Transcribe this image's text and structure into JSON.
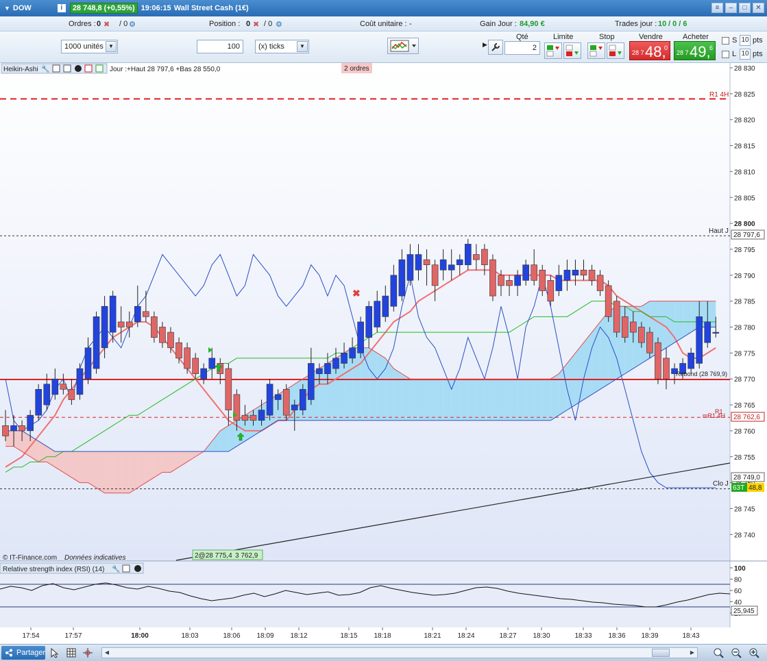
{
  "titlebar": {
    "symbol": "DOW",
    "price_badge": "28 748,8 (+0,55%)",
    "time": "19:06:15",
    "instrument": "Wall Street Cash (1€)"
  },
  "infobar": {
    "orders_label": "Ordres :",
    "orders_value": "0",
    "orders_slash": "/ 0",
    "position_label": "Position :",
    "position_value": "0",
    "position_slash": "/ 0",
    "unit_cost_label": "Coût unitaire :",
    "unit_cost_value": "-",
    "gain_label": "Gain Jour :",
    "gain_value": "84,90 €",
    "trades_label": "Trades jour :",
    "trades_value": "10",
    "trades_rest": "/ 0 / 6"
  },
  "controls": {
    "units_select": "1000 unités",
    "ticks_value": "100",
    "ticks_select": "(x) ticks",
    "qty_label": "Qté",
    "qty_value": "2",
    "limit_label": "Limite",
    "stop_label": "Stop",
    "sell_label": "Vendre",
    "buy_label": "Acheter",
    "sell_small": "28 7",
    "sell_big": "48,",
    "sell_sup": "0",
    "buy_small": "28 7",
    "buy_big": "49,",
    "buy_sup": "6",
    "s_label": "S",
    "l_label": "L",
    "s_pts_value": "10",
    "l_pts_value": "10",
    "pts_label": "pts"
  },
  "chart": {
    "indicator_name": "Heikin-Ashi",
    "day_info": "Jour :+Haut 28 797,6 +Bas 28 550,0",
    "orders_badge": "2 ordres",
    "copyright": "© IT-Finance.com",
    "disclaimer": "Données indicatives",
    "r1_4h_label": "R1 4H",
    "haut_j_label": "Haut J",
    "haut_j_value": "28 797,6",
    "rebond_label": "Rebond (28 769,9)",
    "r1_label": "R1",
    "mr1_label": "mR1 4H",
    "r1_value": "28 762,6",
    "clo_j_label": "Clo J",
    "last_value": "28 749,0",
    "counter_badge": "63T",
    "current_value": "48,8",
    "trendline_badge": "2@28 775,4",
    "trendline_value": "3 762,9",
    "y_ticks": [
      "28 830",
      "28 825",
      "28 820",
      "28 815",
      "28 810",
      "28 805",
      "28 800",
      "28 795",
      "28 790",
      "28 785",
      "28 780",
      "28 775",
      "28 770",
      "28 765",
      "28 760",
      "28 755",
      "28 750",
      "28 745",
      "28 740"
    ],
    "y_tick_bold_index": 6,
    "x_ticks": [
      "17:54",
      "17:57",
      "18:00",
      "18:03",
      "18:06",
      "18:09",
      "18:12",
      "18:15",
      "18:18",
      "18:21",
      "18:24",
      "18:27",
      "18:30",
      "18:33",
      "18:36",
      "18:39",
      "18:43"
    ],
    "x_tick_bold_index": 2
  },
  "rsi": {
    "title": "Relative strength index (RSI) (14)",
    "ticks": [
      "100",
      "80",
      "60",
      "40",
      "20"
    ],
    "current_value": "25,945"
  },
  "bottombar": {
    "share_label": "Partager"
  },
  "colors": {
    "bull_candle": "#2244dd",
    "bear_candle": "#e06666",
    "kumo_bull": "#a8dcf5",
    "kumo_bear": "#f3c8c8",
    "support_line": "#e02020"
  },
  "chart_data": {
    "type": "candlestick",
    "title": "DOW — Wall Street Cash (1€) — Heikin-Ashi",
    "ylim": [
      28737,
      28832
    ],
    "x_first_label": "17:54",
    "x_last_label": "18:43",
    "candles": [
      {
        "o": 28761,
        "h": 28764,
        "l": 28758,
        "c": 28759
      },
      {
        "o": 28760,
        "h": 28763,
        "l": 28757,
        "c": 28761
      },
      {
        "o": 28761,
        "h": 28762,
        "l": 28758,
        "c": 28760
      },
      {
        "o": 28760,
        "h": 28764,
        "l": 28758,
        "c": 28763
      },
      {
        "o": 28763,
        "h": 28769,
        "l": 28762,
        "c": 28768
      },
      {
        "o": 28765,
        "h": 28771,
        "l": 28764,
        "c": 28769
      },
      {
        "o": 28767,
        "h": 28772,
        "l": 28766,
        "c": 28770
      },
      {
        "o": 28769,
        "h": 28771,
        "l": 28767,
        "c": 28768
      },
      {
        "o": 28768,
        "h": 28770,
        "l": 28765,
        "c": 28766
      },
      {
        "o": 28767,
        "h": 28773,
        "l": 28766,
        "c": 28772
      },
      {
        "o": 28770,
        "h": 28778,
        "l": 28769,
        "c": 28776
      },
      {
        "o": 28772,
        "h": 28783,
        "l": 28771,
        "c": 28782
      },
      {
        "o": 28776,
        "h": 28786,
        "l": 28774,
        "c": 28784
      },
      {
        "o": 28779,
        "h": 28787,
        "l": 28777,
        "c": 28786
      },
      {
        "o": 28781,
        "h": 28784,
        "l": 28777,
        "c": 28780
      },
      {
        "o": 28781,
        "h": 28783,
        "l": 28778,
        "c": 28780
      },
      {
        "o": 28781,
        "h": 28788,
        "l": 28780,
        "c": 28784
      },
      {
        "o": 28783,
        "h": 28787,
        "l": 28781,
        "c": 28782
      },
      {
        "o": 28782,
        "h": 28783,
        "l": 28777,
        "c": 28778
      },
      {
        "o": 28780,
        "h": 28781,
        "l": 28776,
        "c": 28777
      },
      {
        "o": 28779,
        "h": 28780,
        "l": 28775,
        "c": 28776
      },
      {
        "o": 28777,
        "h": 28778,
        "l": 28773,
        "c": 28774
      },
      {
        "o": 28776,
        "h": 28777,
        "l": 28771,
        "c": 28772
      },
      {
        "o": 28774,
        "h": 28775,
        "l": 28770,
        "c": 28771
      },
      {
        "o": 28770,
        "h": 28773,
        "l": 28769,
        "c": 28772
      },
      {
        "o": 28772,
        "h": 28776,
        "l": 28770,
        "c": 28774
      },
      {
        "o": 28773,
        "h": 28774,
        "l": 28769,
        "c": 28771
      },
      {
        "o": 28772,
        "h": 28773,
        "l": 28761,
        "c": 28764
      },
      {
        "o": 28767,
        "h": 28768,
        "l": 28760,
        "c": 28762
      },
      {
        "o": 28763,
        "h": 28765,
        "l": 28761,
        "c": 28762
      },
      {
        "o": 28763,
        "h": 28764,
        "l": 28761,
        "c": 28762
      },
      {
        "o": 28762,
        "h": 28766,
        "l": 28761,
        "c": 28764
      },
      {
        "o": 28763,
        "h": 28770,
        "l": 28762,
        "c": 28769
      },
      {
        "o": 28766,
        "h": 28768,
        "l": 28764,
        "c": 28767
      },
      {
        "o": 28768,
        "h": 28769,
        "l": 28762,
        "c": 28763
      },
      {
        "o": 28764,
        "h": 28766,
        "l": 28760,
        "c": 28765
      },
      {
        "o": 28764,
        "h": 28769,
        "l": 28763,
        "c": 28768
      },
      {
        "o": 28766,
        "h": 28776,
        "l": 28765,
        "c": 28773
      },
      {
        "o": 28771,
        "h": 28773,
        "l": 28769,
        "c": 28772
      },
      {
        "o": 28771,
        "h": 28775,
        "l": 28769,
        "c": 28773
      },
      {
        "o": 28772,
        "h": 28776,
        "l": 28771,
        "c": 28774
      },
      {
        "o": 28773,
        "h": 28777,
        "l": 28772,
        "c": 28775
      },
      {
        "o": 28774,
        "h": 28778,
        "l": 28773,
        "c": 28776
      },
      {
        "o": 28775,
        "h": 28782,
        "l": 28774,
        "c": 28781
      },
      {
        "o": 28778,
        "h": 28785,
        "l": 28776,
        "c": 28784
      },
      {
        "o": 28780,
        "h": 28787,
        "l": 28779,
        "c": 28785
      },
      {
        "o": 28782,
        "h": 28788,
        "l": 28781,
        "c": 28786
      },
      {
        "o": 28784,
        "h": 28792,
        "l": 28783,
        "c": 28790
      },
      {
        "o": 28786,
        "h": 28795,
        "l": 28785,
        "c": 28793
      },
      {
        "o": 28789,
        "h": 28796,
        "l": 28788,
        "c": 28794
      },
      {
        "o": 28791,
        "h": 28796,
        "l": 28789,
        "c": 28794
      },
      {
        "o": 28793,
        "h": 28795,
        "l": 28788,
        "c": 28792
      },
      {
        "o": 28792,
        "h": 28793,
        "l": 28785,
        "c": 28788
      },
      {
        "o": 28791,
        "h": 28795,
        "l": 28789,
        "c": 28793
      },
      {
        "o": 28791,
        "h": 28795,
        "l": 28789,
        "c": 28792
      },
      {
        "o": 28792,
        "h": 28794,
        "l": 28790,
        "c": 28793
      },
      {
        "o": 28792,
        "h": 28797,
        "l": 28791,
        "c": 28796
      },
      {
        "o": 28794,
        "h": 28796,
        "l": 28791,
        "c": 28793
      },
      {
        "o": 28795,
        "h": 28796,
        "l": 28790,
        "c": 28792
      },
      {
        "o": 28793,
        "h": 28794,
        "l": 28785,
        "c": 28786
      },
      {
        "o": 28790,
        "h": 28791,
        "l": 28786,
        "c": 28788
      },
      {
        "o": 28789,
        "h": 28790,
        "l": 28786,
        "c": 28788
      },
      {
        "o": 28788,
        "h": 28791,
        "l": 28786,
        "c": 28790
      },
      {
        "o": 28789,
        "h": 28793,
        "l": 28788,
        "c": 28792
      },
      {
        "o": 28792,
        "h": 28795,
        "l": 28788,
        "c": 28789
      },
      {
        "o": 28791,
        "h": 28792,
        "l": 28786,
        "c": 28787
      },
      {
        "o": 28789,
        "h": 28790,
        "l": 28784,
        "c": 28785
      },
      {
        "o": 28787,
        "h": 28792,
        "l": 28786,
        "c": 28790
      },
      {
        "o": 28789,
        "h": 28793,
        "l": 28787,
        "c": 28791
      },
      {
        "o": 28790,
        "h": 28793,
        "l": 28788,
        "c": 28791
      },
      {
        "o": 28791,
        "h": 28793,
        "l": 28789,
        "c": 28790
      },
      {
        "o": 28791,
        "h": 28792,
        "l": 28788,
        "c": 28789
      },
      {
        "o": 28790,
        "h": 28791,
        "l": 28786,
        "c": 28787
      },
      {
        "o": 28788,
        "h": 28789,
        "l": 28781,
        "c": 28782
      },
      {
        "o": 28785,
        "h": 28786,
        "l": 28778,
        "c": 28779
      },
      {
        "o": 28782,
        "h": 28784,
        "l": 28777,
        "c": 28778
      },
      {
        "o": 28781,
        "h": 28783,
        "l": 28777,
        "c": 28779
      },
      {
        "o": 28780,
        "h": 28781,
        "l": 28776,
        "c": 28777
      },
      {
        "o": 28779,
        "h": 28780,
        "l": 28774,
        "c": 28775
      },
      {
        "o": 28777,
        "h": 28778,
        "l": 28769,
        "c": 28770
      },
      {
        "o": 28774,
        "h": 28776,
        "l": 28768,
        "c": 28770
      },
      {
        "o": 28771,
        "h": 28773,
        "l": 28769,
        "c": 28772
      },
      {
        "o": 28771,
        "h": 28774,
        "l": 28770,
        "c": 28773
      },
      {
        "o": 28772,
        "h": 28776,
        "l": 28771,
        "c": 28775
      },
      {
        "o": 28773,
        "h": 28785,
        "l": 28772,
        "c": 28782
      },
      {
        "o": 28777,
        "h": 28785,
        "l": 28776,
        "c": 28781
      },
      {
        "o": 28779,
        "h": 28782,
        "l": 28778,
        "c": 28779
      }
    ],
    "series": [
      {
        "name": "Kijun",
        "color": "#f07070",
        "values": [
          28753,
          28754,
          28755,
          28757,
          28759,
          28761,
          28763,
          28766,
          28768,
          28770,
          28772,
          28774,
          28776,
          28778,
          28779,
          28780,
          28781,
          28781,
          28780,
          28778,
          28776,
          28774,
          28772,
          28770,
          28768,
          28766,
          28764,
          28762,
          28761,
          28760,
          28760,
          28760,
          28761,
          28762,
          28762,
          28764,
          28766,
          28768,
          28769,
          28769,
          28770,
          28771,
          28772,
          28773,
          28775,
          28777,
          28779,
          28781,
          28782,
          28783,
          28785,
          28786,
          28787,
          28788,
          28789,
          28790,
          28791,
          28791,
          28791,
          28791,
          28790,
          28790,
          28790,
          28790,
          28790,
          28790,
          28790,
          28789,
          28789,
          28789,
          28789,
          28789,
          28789,
          28788,
          28786,
          28785,
          28784,
          28783,
          28782,
          28781,
          28780,
          28778,
          28775,
          28774,
          28774,
          28775,
          28776
        ]
      },
      {
        "name": "Tenkan",
        "color": "#22bb22",
        "values": [
          28752,
          28753,
          28753,
          28754,
          28754,
          28755,
          28755,
          28756,
          28756,
          28757,
          28758,
          28759,
          28760,
          28761,
          28762,
          28763,
          28763,
          28764,
          28765,
          28766,
          28767,
          28768,
          28769,
          28770,
          28771,
          28772,
          28773,
          28773,
          28774,
          28774,
          28774,
          28774,
          28774,
          28774,
          28774,
          28774,
          28774,
          28774,
          28774,
          28774,
          28775,
          28775,
          28776,
          28777,
          28778,
          28779,
          28779,
          28779,
          28779,
          28779,
          28779,
          28779,
          28779,
          28779,
          28779,
          28779,
          28779,
          28779,
          28779,
          28779,
          28779,
          28779,
          28780,
          28781,
          28782,
          28782,
          28782,
          28782,
          28782,
          28783,
          28784,
          28785,
          28785,
          28785,
          28784,
          28784,
          28783,
          28783,
          28782,
          28782,
          28782,
          28781,
          28781,
          28781,
          28781,
          28781,
          28781
        ]
      },
      {
        "name": "Chikou",
        "color": "#2a4fc4",
        "values": [
          28770,
          28762,
          28760,
          28761,
          28762,
          28764,
          28768,
          28770,
          28766,
          28772,
          28776,
          28778,
          28780,
          28778,
          28776,
          28780,
          28784,
          28786,
          28790,
          28794,
          28792,
          28790,
          28788,
          28786,
          28788,
          28792,
          28794,
          28790,
          28786,
          28788,
          28794,
          28792,
          28790,
          28786,
          28784,
          28786,
          28788,
          28792,
          28790,
          28786,
          28790,
          28788,
          28782,
          28776,
          28772,
          28770,
          28772,
          28776,
          28784,
          28790,
          28782,
          28778,
          28776,
          28772,
          28768,
          28772,
          28778,
          28774,
          28770,
          28776,
          28784,
          28778,
          28770,
          28780,
          28784,
          28790,
          28784,
          28776,
          28768,
          28762,
          28770,
          28776,
          28780,
          28778,
          28774,
          28768,
          28762,
          28756,
          28752,
          28750,
          28749,
          28749,
          28749,
          28749,
          28749,
          28749,
          28749
        ]
      },
      {
        "name": "SSA",
        "color": "#e05050",
        "values": [
          28757,
          28757,
          28756,
          28755,
          28754,
          28754,
          28753,
          28752,
          28751,
          28750,
          28750,
          28749,
          28748,
          28748,
          28748,
          28748,
          28749,
          28750,
          28751,
          28752,
          28752,
          28753,
          28754,
          28755,
          28756,
          28758,
          28760,
          28761,
          28762,
          28763,
          28764,
          28765,
          28766,
          28767,
          28768,
          28769,
          28770,
          28771,
          28772,
          28773,
          28774,
          28775,
          28776,
          28776,
          28776,
          28775,
          28774,
          28772,
          28771,
          28770,
          28770,
          28770,
          28770,
          28770,
          28770,
          28770,
          28770,
          28770,
          28770,
          28770,
          28770,
          28770,
          28770,
          28770,
          28770,
          28770,
          28770,
          28771,
          28773,
          28775,
          28777,
          28779,
          28781,
          28783,
          28784,
          28784,
          28784,
          28784,
          28785,
          28785,
          28785,
          28785,
          28785,
          28785,
          28785,
          28785,
          28785
        ]
      },
      {
        "name": "SSB",
        "color": "#3050c0",
        "values": [
          28760,
          28760,
          28760,
          28759,
          28758,
          28757,
          28756,
          28756,
          28756,
          28756,
          28756,
          28756,
          28756,
          28756,
          28756,
          28756,
          28756,
          28756,
          28756,
          28756,
          28756,
          28756,
          28756,
          28756,
          28756,
          28756,
          28756,
          28756,
          28757,
          28758,
          28759,
          28760,
          28761,
          28762,
          28762,
          28762,
          28762,
          28762,
          28762,
          28762,
          28762,
          28762,
          28762,
          28762,
          28762,
          28762,
          28762,
          28762,
          28762,
          28762,
          28762,
          28762,
          28762,
          28762,
          28762,
          28762,
          28762,
          28762,
          28762,
          28762,
          28762,
          28762,
          28762,
          28762,
          28762,
          28762,
          28762,
          28763,
          28764,
          28765,
          28766,
          28767,
          28768,
          28769,
          28770,
          28771,
          28772,
          28773,
          28774,
          28775,
          28776,
          28777,
          28778,
          28779,
          28780,
          28780,
          28780
        ]
      }
    ],
    "horizontal_lines": [
      {
        "label": "R1 4H",
        "value": 28824
      },
      {
        "label": "Haut J",
        "value": 28797.6
      },
      {
        "label": "Rebond",
        "value": 28769.9
      },
      {
        "label": "mR1 4H",
        "value": 28762.6
      },
      {
        "label": "Clo J",
        "value": 28748.8
      }
    ]
  }
}
